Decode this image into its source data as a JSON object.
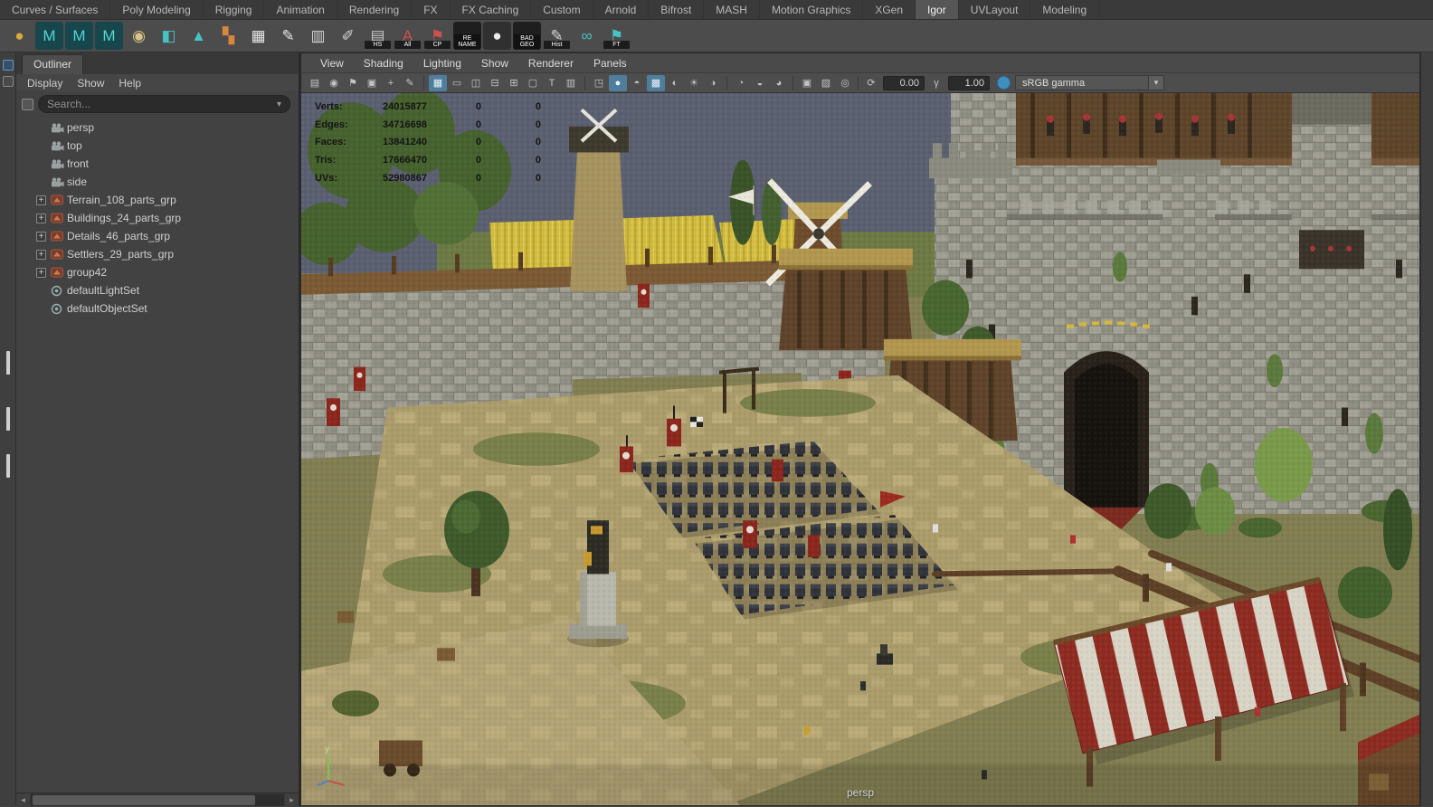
{
  "colors": {
    "active_tool_highlight": "#4f7e9c",
    "viewport_sky": "#5b6071",
    "hud_text": "#141414",
    "banner_red": "#8c261d"
  },
  "menubar": {
    "tabs": [
      {
        "label": "Curves / Surfaces"
      },
      {
        "label": "Poly Modeling"
      },
      {
        "label": "Rigging"
      },
      {
        "label": "Animation"
      },
      {
        "label": "Rendering"
      },
      {
        "label": "FX"
      },
      {
        "label": "FX Caching"
      },
      {
        "label": "Custom"
      },
      {
        "label": "Arnold"
      },
      {
        "label": "Bifrost"
      },
      {
        "label": "MASH"
      },
      {
        "label": "Motion Graphics"
      },
      {
        "label": "XGen"
      },
      {
        "label": "Igor",
        "active": true
      },
      {
        "label": "UVLayout"
      },
      {
        "label": "Modeling"
      }
    ]
  },
  "shelf": {
    "icons": [
      {
        "name": "poly-sphere",
        "glyph": "●",
        "fg": "#dca93c"
      },
      {
        "name": "maya-tool-1",
        "glyph": "M",
        "fg": "#52d6d6",
        "bg": "#17474c"
      },
      {
        "name": "maya-tool-2",
        "glyph": "M",
        "fg": "#52d6d6",
        "bg": "#17474c"
      },
      {
        "name": "maya-tool-3",
        "glyph": "M",
        "fg": "#52d6d6",
        "bg": "#17474c"
      },
      {
        "name": "poly-disc",
        "glyph": "◉",
        "fg": "#d8c48a"
      },
      {
        "name": "export-cube",
        "glyph": "◧",
        "fg": "#46c4c4"
      },
      {
        "name": "scatter",
        "glyph": "▲",
        "fg": "#46c4c4"
      },
      {
        "name": "blocks",
        "glyph": "▚",
        "fg": "#d8883c"
      },
      {
        "name": "uv-grid",
        "glyph": "▦",
        "fg": "#e6e6e6"
      },
      {
        "name": "curve-pen",
        "glyph": "✎",
        "fg": "#e6e6e6"
      },
      {
        "name": "uv-strips",
        "glyph": "▥",
        "fg": "#d4d4d4"
      },
      {
        "name": "pen-dashed",
        "glyph": "✐",
        "fg": "#d4d4d4"
      },
      {
        "name": "hud-stats",
        "glyph": "▤",
        "fg": "#c8c8c8",
        "label": "HS"
      },
      {
        "name": "select-all",
        "glyph": "A",
        "fg": "#d05050",
        "label": "All"
      },
      {
        "name": "center-pivot",
        "glyph": "⚑",
        "fg": "#d05050",
        "label": "CP"
      },
      {
        "name": "rename",
        "bg": "#1e1e1e",
        "label": "RE\nNAME"
      },
      {
        "name": "white-sphere",
        "glyph": "●",
        "fg": "#ececec",
        "bg": "#303030"
      },
      {
        "name": "bad-geo",
        "bg": "#1e1e1e",
        "label": "BAD\nGEO"
      },
      {
        "name": "delete-history",
        "glyph": "✎",
        "fg": "#d8d8d8",
        "label": "Hist"
      },
      {
        "name": "booleans",
        "glyph": "∞",
        "fg": "#46c4c4"
      },
      {
        "name": "freeze-transform",
        "glyph": "⚑",
        "fg": "#46c4c4",
        "label": "FT"
      }
    ]
  },
  "outliner": {
    "tab": "Outliner",
    "menus": [
      "Display",
      "Show",
      "Help"
    ],
    "search_placeholder": "Search...",
    "items": [
      {
        "label": "persp",
        "type": "camera"
      },
      {
        "label": "top",
        "type": "camera"
      },
      {
        "label": "front",
        "type": "camera"
      },
      {
        "label": "side",
        "type": "camera"
      },
      {
        "label": "Terrain_108_parts_grp",
        "type": "group",
        "expandable": true
      },
      {
        "label": "Buildings_24_parts_grp",
        "type": "group",
        "expandable": true
      },
      {
        "label": "Details_46_parts_grp",
        "type": "group",
        "expandable": true
      },
      {
        "label": "Settlers_29_parts_grp",
        "type": "group",
        "expandable": true
      },
      {
        "label": "group42",
        "type": "group",
        "expandable": true
      },
      {
        "label": "defaultLightSet",
        "type": "set"
      },
      {
        "label": "defaultObjectSet",
        "type": "set"
      }
    ]
  },
  "viewport": {
    "menus": [
      "View",
      "Shading",
      "Lighting",
      "Show",
      "Renderer",
      "Panels"
    ],
    "toolbar": {
      "groups": [
        {
          "name": "camera-tools",
          "icons": [
            {
              "name": "select-camera-icon",
              "glyph": "▤"
            },
            {
              "name": "lock-camera-icon",
              "glyph": "◉"
            },
            {
              "name": "bookmark-icon",
              "glyph": "⚑"
            },
            {
              "name": "image-plane-icon",
              "glyph": "▣"
            },
            {
              "name": "pan-zoom-icon",
              "glyph": "+"
            },
            {
              "name": "hud-pencil-icon",
              "glyph": "✎"
            }
          ]
        },
        {
          "name": "gate-tools",
          "icons": [
            {
              "name": "grid-icon",
              "glyph": "▦",
              "active": true
            },
            {
              "name": "film-gate-icon",
              "glyph": "▭"
            },
            {
              "name": "resolution-gate-icon",
              "glyph": "◫"
            },
            {
              "name": "gate-mask-icon",
              "glyph": "⊟"
            },
            {
              "name": "field-chart-icon",
              "glyph": "⊞"
            },
            {
              "name": "safe-action-icon",
              "glyph": "▢"
            },
            {
              "name": "safe-title-icon",
              "glyph": "T"
            },
            {
              "name": "hud-box-icon",
              "glyph": "▥"
            }
          ]
        },
        {
          "name": "shading-tools",
          "icons": [
            {
              "name": "wireframe-icon",
              "glyph": "◳"
            },
            {
              "name": "smooth-shade-icon",
              "glyph": "●",
              "active": true
            },
            {
              "name": "flat-shade-icon",
              "glyph": "◓"
            },
            {
              "name": "textured-icon",
              "glyph": "▩",
              "active": true
            },
            {
              "name": "default-material-icon",
              "glyph": "◐"
            },
            {
              "name": "lighting-icon",
              "glyph": "☀"
            },
            {
              "name": "shadows-icon",
              "glyph": "◑"
            }
          ]
        },
        {
          "name": "post-effects",
          "icons": [
            {
              "name": "ambient-occlusion-icon",
              "glyph": "◔"
            },
            {
              "name": "motion-blur-icon",
              "glyph": "◒"
            },
            {
              "name": "depth-of-field-icon",
              "glyph": "◕"
            }
          ]
        },
        {
          "name": "view-tools",
          "icons": [
            {
              "name": "isolate-select-icon",
              "glyph": "▣"
            },
            {
              "name": "xray-icon",
              "glyph": "▨"
            },
            {
              "name": "joints-xray-icon",
              "glyph": "◎"
            }
          ]
        }
      ],
      "exposure_icon": "⟳",
      "exposure": "0.00",
      "gamma_icon": "γ",
      "gamma": "1.00",
      "view_transform": "sRGB gamma"
    },
    "hud": {
      "rows": [
        {
          "label": "Verts:",
          "value": "24015877",
          "selected": "0",
          "other": "0"
        },
        {
          "label": "Edges:",
          "value": "34716698",
          "selected": "0",
          "other": "0"
        },
        {
          "label": "Faces:",
          "value": "13841240",
          "selected": "0",
          "other": "0"
        },
        {
          "label": "Tris:",
          "value": "17666470",
          "selected": "0",
          "other": "0"
        },
        {
          "label": "UVs:",
          "value": "52980867",
          "selected": "0",
          "other": "0"
        }
      ]
    },
    "axis_up_label": "y",
    "camera_label": "persp"
  }
}
